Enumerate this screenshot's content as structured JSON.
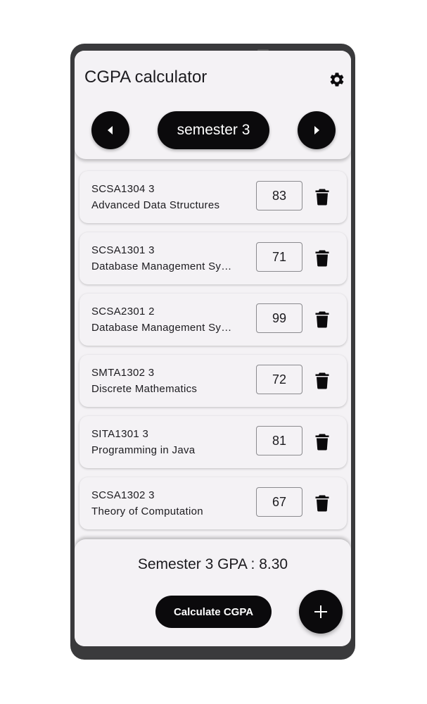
{
  "app": {
    "title": "CGPA calculator",
    "settings_icon": "gear-icon"
  },
  "semester_nav": {
    "prev_icon": "chevron-left-icon",
    "label": "semester 3",
    "next_icon": "chevron-right-icon"
  },
  "courses": [
    {
      "code": "SCSA1304 3",
      "name": "Advanced Data Structures",
      "score": "83"
    },
    {
      "code": "SCSA1301 3",
      "name": "Database Management Systems",
      "score": "71"
    },
    {
      "code": "SCSA2301 2",
      "name": "Database Management Systems Lab",
      "score": "99"
    },
    {
      "code": "SMTA1302 3",
      "name": "Discrete Mathematics",
      "score": "72"
    },
    {
      "code": "SITA1301 3",
      "name": "Programming in Java",
      "score": "81"
    },
    {
      "code": "SCSA1302 3",
      "name": "Theory of Computation",
      "score": "67"
    }
  ],
  "footer": {
    "gpa_text": "Semester 3 GPA : 8.30",
    "calculate_label": "Calculate CGPA",
    "add_icon": "plus-icon"
  },
  "colors": {
    "accent": "#0b0a0c",
    "surface": "#f4f2f5",
    "frame": "#3a3a3c"
  }
}
